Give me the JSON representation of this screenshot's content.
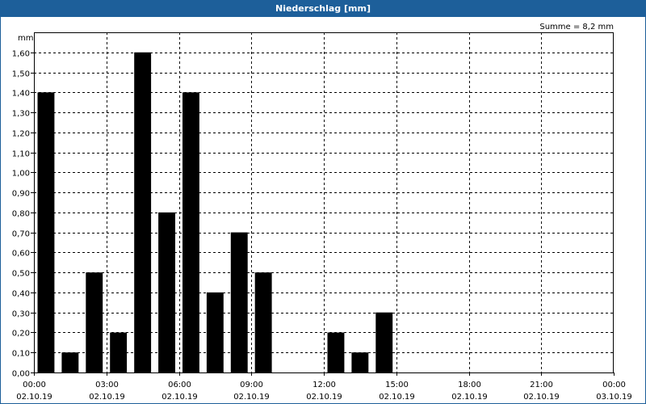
{
  "window": {
    "title": "Niederschlag [mm]"
  },
  "chart_data": {
    "type": "bar",
    "title": "Niederschlag [mm]",
    "ylabel": "mm",
    "sum_label": "Summe = 8,2 mm",
    "ylim": [
      0,
      1.7
    ],
    "y_ticks": [
      "0,00",
      "0,10",
      "0,20",
      "0,30",
      "0,40",
      "0,50",
      "0,60",
      "0,70",
      "0,80",
      "0,90",
      "1,00",
      "1,10",
      "1,20",
      "1,30",
      "1,40",
      "1,50",
      "1,60"
    ],
    "x_ticks": [
      {
        "time": "00:00",
        "date": "02.10.19"
      },
      {
        "time": "03:00",
        "date": "02.10.19"
      },
      {
        "time": "06:00",
        "date": "02.10.19"
      },
      {
        "time": "09:00",
        "date": "02.10.19"
      },
      {
        "time": "12:00",
        "date": "02.10.19"
      },
      {
        "time": "15:00",
        "date": "02.10.19"
      },
      {
        "time": "18:00",
        "date": "02.10.19"
      },
      {
        "time": "21:00",
        "date": "02.10.19"
      },
      {
        "time": "00:00",
        "date": "03.10.19"
      }
    ],
    "bars": [
      {
        "hour": 0,
        "value": 1.4
      },
      {
        "hour": 1,
        "value": 0.1
      },
      {
        "hour": 2,
        "value": 0.5
      },
      {
        "hour": 3,
        "value": 0.2
      },
      {
        "hour": 4,
        "value": 1.6
      },
      {
        "hour": 5,
        "value": 0.8
      },
      {
        "hour": 6,
        "value": 1.4
      },
      {
        "hour": 7,
        "value": 0.4
      },
      {
        "hour": 8,
        "value": 0.7
      },
      {
        "hour": 9,
        "value": 0.5
      },
      {
        "hour": 12,
        "value": 0.2
      },
      {
        "hour": 13,
        "value": 0.1
      },
      {
        "hour": 14,
        "value": 0.3
      }
    ],
    "grid": true,
    "colors": {
      "bar": "#000000",
      "titlebar": "#1d5f9a",
      "grid": "#000000"
    }
  }
}
